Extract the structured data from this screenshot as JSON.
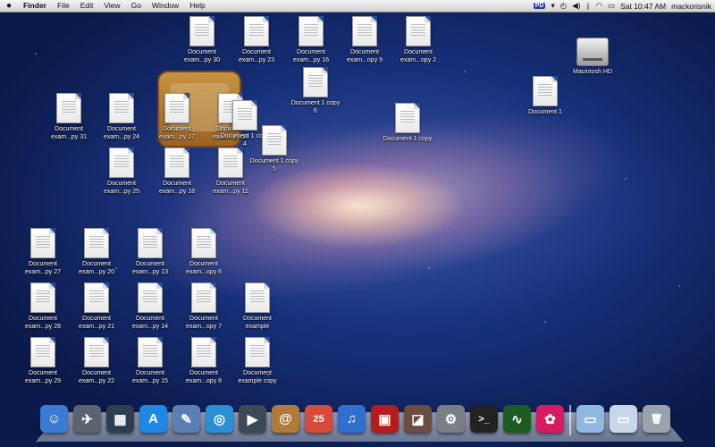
{
  "menubar": {
    "apple_icon": "apple-icon",
    "app_name": "Finder",
    "menus": [
      "File",
      "Edit",
      "View",
      "Go",
      "Window",
      "Help"
    ],
    "status_badge": "PD",
    "clock": "Sat 10:47 AM",
    "user": "mackorisnik"
  },
  "desktop": {
    "hd_label": "Macintosh HD",
    "docs": {
      "d30": "Document exam...py 30",
      "d23": "Document exam...py 23",
      "d16": "Document exam...py 16",
      "d9": "Document exam...opy 9",
      "d2": "Document exam...opy 2",
      "c6": "Document 1 copy 6",
      "d1": "Document 1",
      "d31": "Document exam...py 31",
      "d24": "Document exam...py 24",
      "d17": "Document exam...py 17",
      "d10": "Document exam...py 10",
      "c4": "Document 1 copy 4",
      "c5": "Document 1 copy 5",
      "c1": "Document 1 copy",
      "d25": "Document exam...py 25",
      "d18": "Document exam...py 18",
      "d11": "Document exam...py 11",
      "d27": "Document exam...py 27",
      "d20": "Document exam...py 20",
      "d13": "Document exam...py 13",
      "d6": "Document exam...opy 6",
      "d28": "Document exam...py 28",
      "d21": "Document exam...py 21",
      "d14": "Document exam...py 14",
      "d7": "Document exam...opy 7",
      "dex": "Document example",
      "d29": "Document exam...py 29",
      "d22": "Document exam...py 22",
      "d15": "Document exam...py 15",
      "d8": "Document exam...opy 8",
      "dexc": "Document example copy"
    }
  },
  "dock": {
    "items": [
      {
        "name": "finder-icon",
        "glyph": "☺",
        "color": "#3a7bd5"
      },
      {
        "name": "launchpad-icon",
        "glyph": "✈",
        "color": "#5a6470"
      },
      {
        "name": "mission-control-icon",
        "glyph": "▦",
        "color": "#2c3e50"
      },
      {
        "name": "app-store-icon",
        "glyph": "A",
        "color": "#1e88e5"
      },
      {
        "name": "preview-icon",
        "glyph": "✎",
        "color": "#5b7fb5"
      },
      {
        "name": "safari-icon",
        "glyph": "◎",
        "color": "#2a8fd6"
      },
      {
        "name": "facetime-icon",
        "glyph": "▶",
        "color": "#3d4a56"
      },
      {
        "name": "address-book-icon",
        "glyph": "@",
        "color": "#b07a38"
      },
      {
        "name": "ical-icon",
        "glyph": "25",
        "color": "#d94a3a"
      },
      {
        "name": "itunes-icon",
        "glyph": "♫",
        "color": "#2f6fd0"
      },
      {
        "name": "photo-booth-icon",
        "glyph": "▣",
        "color": "#b71c1c"
      },
      {
        "name": "iphoto-icon",
        "glyph": "◪",
        "color": "#6d4c41"
      },
      {
        "name": "system-preferences-icon",
        "glyph": "⚙",
        "color": "#7a7f85"
      },
      {
        "name": "terminal-icon",
        "glyph": ">_",
        "color": "#222222"
      },
      {
        "name": "activity-monitor-icon",
        "glyph": "∿",
        "color": "#1b5e20"
      },
      {
        "name": "app-icon",
        "glyph": "✿",
        "color": "#d81b60"
      }
    ],
    "right_items": [
      {
        "name": "applications-folder-icon",
        "glyph": "▭",
        "color": "#8fb7e0"
      },
      {
        "name": "downloads-folder-icon",
        "glyph": "▭",
        "color": "#c7d7e8"
      },
      {
        "name": "trash-icon",
        "glyph": "🗑",
        "color": "#9aa3ab"
      }
    ]
  }
}
